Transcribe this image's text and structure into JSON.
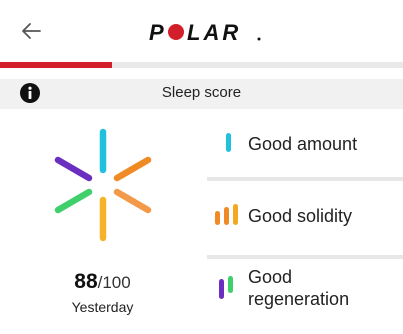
{
  "header": {
    "brand": "POLAR"
  },
  "section": {
    "title": "Sleep score"
  },
  "score": {
    "value": "88",
    "max": "/100",
    "period": "Yesterday"
  },
  "metrics": [
    {
      "label": "Good amount",
      "color": "#21c0dd"
    },
    {
      "label": "Good solidity",
      "colors": [
        "#f08a24",
        "#f5a623"
      ]
    },
    {
      "label": "Good\nregeneration",
      "colors": [
        "#6a2fc1",
        "#3fcf6b"
      ]
    }
  ],
  "star_colors": [
    "#21c0dd",
    "#f08a24",
    "#f39a4a",
    "#f5b32a",
    "#3fcf6b",
    "#6a2fc1"
  ],
  "accent": "#d21f2b"
}
